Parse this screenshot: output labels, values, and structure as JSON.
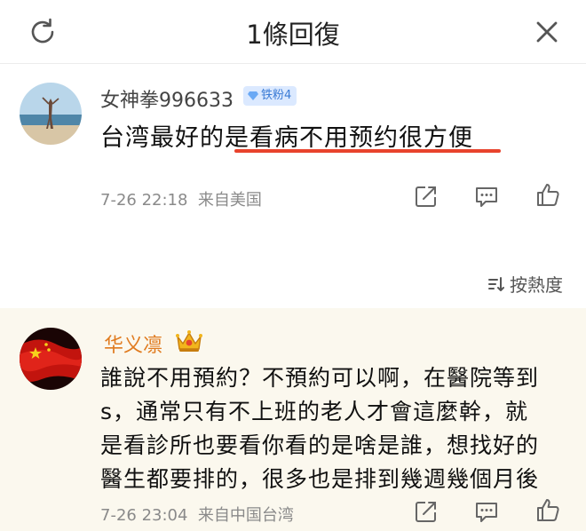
{
  "header": {
    "title": "1條回復",
    "refresh_icon": "refresh-icon",
    "close_icon": "close-icon"
  },
  "main_comment": {
    "username": "女神拳996633",
    "badge_label": "铁粉4",
    "badge_icon": "diamond-icon",
    "text_part1": "台湾最好的是",
    "text_part2": "看病不用预约很方便",
    "timestamp": "7-26 22:18",
    "source": "来自美国",
    "highlight_color": "#e8432d"
  },
  "sort": {
    "label": "按熱度"
  },
  "reply": {
    "username": "华义凛",
    "username_color": "#e07b1f",
    "lines": [
      "誰說不用預約？不預約可以啊，在醫院等到",
      "s，通常只有不上班的老人才會這麼幹，就",
      "是看診所也要看你看的是啥是誰，想找好的",
      "醫生都要排的，很多也是排到幾週幾個月後"
    ],
    "timestamp": "7-26 23:04",
    "source": "来自中国台湾"
  }
}
